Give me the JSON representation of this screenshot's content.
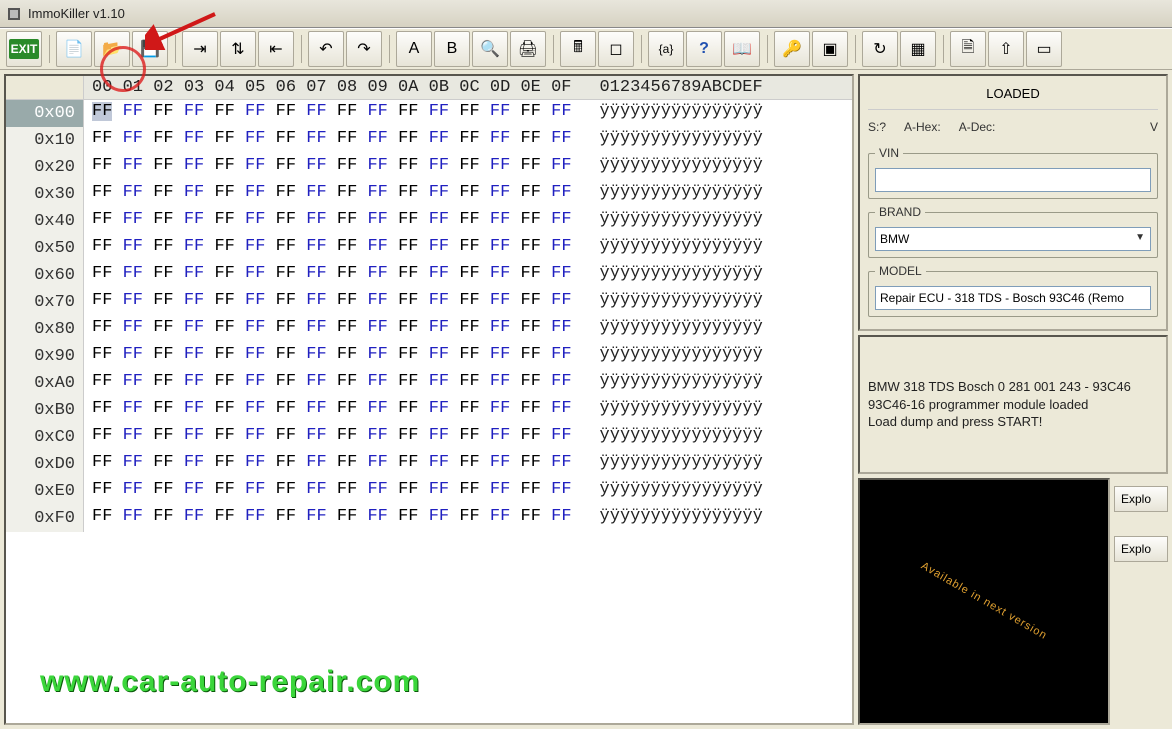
{
  "window": {
    "title": "ImmoKiller v1.10"
  },
  "toolbar": {
    "exit": "EXIT",
    "icons": [
      {
        "name": "exit-icon",
        "glyph": "EXIT"
      },
      {
        "name": "new-file-icon",
        "glyph": "📄"
      },
      {
        "name": "open-file-icon",
        "glyph": "📂"
      },
      {
        "name": "save-icon",
        "glyph": "💾"
      },
      {
        "name": "import-icon",
        "glyph": "⇥"
      },
      {
        "name": "swap-icon",
        "glyph": "⇅"
      },
      {
        "name": "export-icon",
        "glyph": "⇤"
      },
      {
        "name": "undo-icon",
        "glyph": "↶"
      },
      {
        "name": "redo-icon",
        "glyph": "↷"
      },
      {
        "name": "page-a-icon",
        "glyph": "A"
      },
      {
        "name": "page-b-icon",
        "glyph": "B"
      },
      {
        "name": "find-icon",
        "glyph": "🔍"
      },
      {
        "name": "print-icon",
        "glyph": "🖨"
      },
      {
        "name": "calc-icon",
        "glyph": "🖩"
      },
      {
        "name": "window-icon",
        "glyph": "◻"
      },
      {
        "name": "braces-icon",
        "glyph": "{a}"
      },
      {
        "name": "help-icon",
        "glyph": "?"
      },
      {
        "name": "book-icon",
        "glyph": "📖"
      },
      {
        "name": "key-icon",
        "glyph": "🔑"
      },
      {
        "name": "chip-icon",
        "glyph": "▣"
      },
      {
        "name": "refresh-icon",
        "glyph": "↻"
      },
      {
        "name": "module-icon",
        "glyph": "▦"
      },
      {
        "name": "note-icon",
        "glyph": "🗎"
      },
      {
        "name": "up-icon",
        "glyph": "⇧"
      },
      {
        "name": "select-icon",
        "glyph": "▭"
      }
    ]
  },
  "hex": {
    "col_header": "00 01 02 03 04 05 06 07 08 09 0A 0B 0C 0D 0E 0F",
    "ascii_header": "0123456789ABCDEF",
    "offsets": [
      "0x00",
      "0x10",
      "0x20",
      "0x30",
      "0x40",
      "0x50",
      "0x60",
      "0x70",
      "0x80",
      "0x90",
      "0xA0",
      "0xB0",
      "0xC0",
      "0xD0",
      "0xE0",
      "0xF0"
    ],
    "byte": "FF",
    "ascii_row": "ÿÿÿÿÿÿÿÿÿÿÿÿÿÿÿÿ"
  },
  "side": {
    "loaded_label": "LOADED",
    "status": {
      "s": "S:?",
      "ahex": "A-Hex:",
      "adec": "A-Dec:",
      "v": "V"
    },
    "vin_label": "VIN",
    "vin_value": "",
    "brand_label": "BRAND",
    "brand_value": "BMW",
    "model_label": "MODEL",
    "model_value": "Repair ECU - 318 TDS - Bosch 93C46 (Remo",
    "log": "BMW 318 TDS Bosch 0 281 001 243 - 93C46\n93C46-16 programmer module loaded\nLoad  dump and press START!",
    "explore1": "Explo",
    "explore2": "Explo",
    "preview_text": "Available in next version"
  },
  "watermark": "www.car-auto-repair.com"
}
